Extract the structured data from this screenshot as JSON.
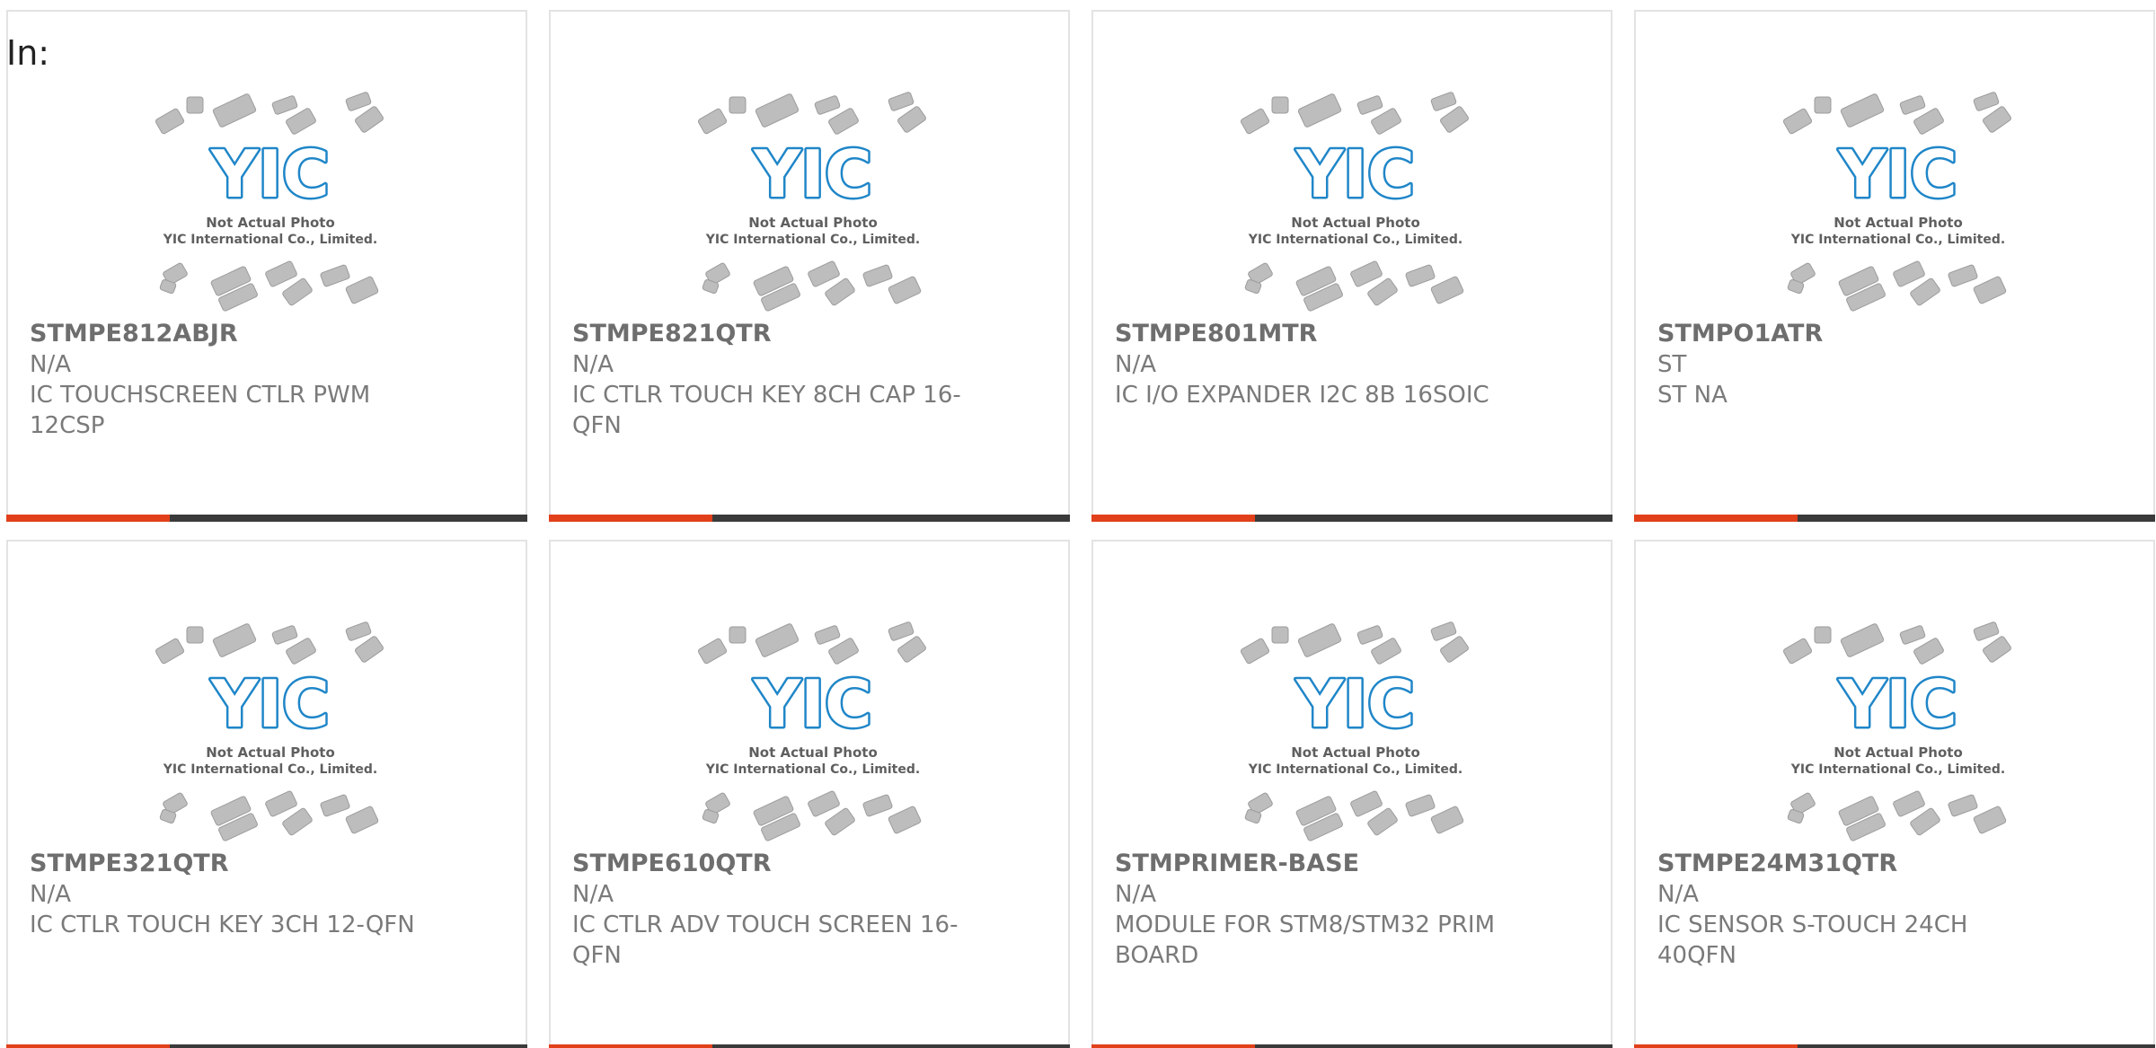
{
  "header": {
    "label": "In:"
  },
  "placeholder": {
    "logo_text": "YIC",
    "line1": "Not Actual Photo",
    "line2": "YIC International Co., Limited."
  },
  "colors": {
    "accent": "#e1401a",
    "bar": "#3a3a3a",
    "logo": "#1f86c8",
    "chip": "#bdbdbd"
  },
  "products": [
    {
      "part": "STMPE812ABJR",
      "mfr": "N/A",
      "desc": "IC TOUCHSCREEN CTLR PWM 12CSP"
    },
    {
      "part": "STMPE821QTR",
      "mfr": "N/A",
      "desc": "IC CTLR TOUCH KEY 8CH CAP 16-QFN"
    },
    {
      "part": "STMPE801MTR",
      "mfr": "N/A",
      "desc": "IC I/O EXPANDER I2C 8B 16SOIC"
    },
    {
      "part": "STMPO1ATR",
      "mfr": "ST",
      "desc": "ST NA"
    },
    {
      "part": "STMPE321QTR",
      "mfr": "N/A",
      "desc": "IC CTLR TOUCH KEY 3CH 12-QFN"
    },
    {
      "part": "STMPE610QTR",
      "mfr": "N/A",
      "desc": "IC CTLR ADV TOUCH SCREEN 16-QFN"
    },
    {
      "part": "STMPRIMER-BASE",
      "mfr": "N/A",
      "desc": "MODULE FOR STM8/STM32 PRIM BOARD"
    },
    {
      "part": "STMPE24M31QTR",
      "mfr": "N/A",
      "desc": "IC SENSOR S-TOUCH 24CH 40QFN"
    }
  ]
}
